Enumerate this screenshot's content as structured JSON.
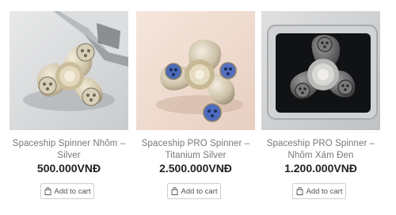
{
  "products": [
    {
      "title_line1": "Spaceship Spinner Nhôm –",
      "title_line2": "Silver",
      "price": "500.000VNĐ",
      "button_label": "Add to cart",
      "image_name": "silver-spinner-image"
    },
    {
      "title_line1": "Spaceship PRO Spinner –",
      "title_line2": "Titanium Silver",
      "price": "2.500.000VNĐ",
      "button_label": "Add to cart",
      "image_name": "titanium-spinner-image"
    },
    {
      "title_line1": "Spaceship PRO Spinner –",
      "title_line2": "Nhôm Xám Đen",
      "price": "1.200.000VNĐ",
      "button_label": "Add to cart",
      "image_name": "dark-gray-spinner-image"
    }
  ],
  "colors": {
    "title": "#777777",
    "price": "#222222",
    "button_border": "#cfcfcf"
  },
  "icons": {
    "button": "shopping-bag-icon"
  }
}
